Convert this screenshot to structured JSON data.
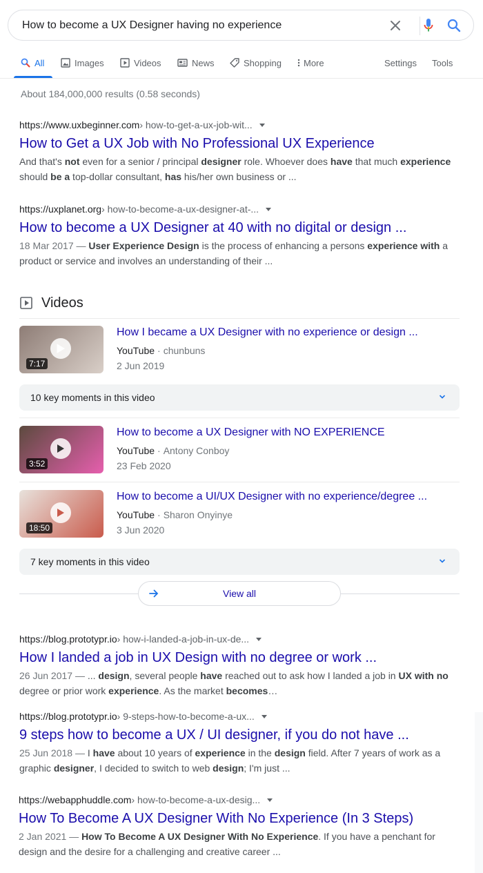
{
  "search": {
    "query": "How to become a UX Designer having no experience"
  },
  "tabs": [
    {
      "label": "All",
      "icon": "search-icon"
    },
    {
      "label": "Images",
      "icon": "image-icon"
    },
    {
      "label": "Videos",
      "icon": "play-square-icon"
    },
    {
      "label": "News",
      "icon": "news-icon"
    },
    {
      "label": "Shopping",
      "icon": "tag-icon"
    },
    {
      "label": "More",
      "icon": "more-vert-icon"
    }
  ],
  "tools": {
    "settings": "Settings",
    "tools": "Tools"
  },
  "result_stats": "About 184,000,000 results (0.58 seconds)",
  "results": [
    {
      "domain": "https://www.uxbeginner.com",
      "path": " › how-to-get-a-ux-job-wit...",
      "title": "How to Get a UX Job with No Professional UX Experience",
      "snippet_html": "And that's <b>not</b> even for a senior / principal <b>designer</b> role. Whoever does <b>have</b> that much <b>experience</b> should <b>be a</b> top-dollar consultant, <b>has</b> his/her own business or ..."
    },
    {
      "domain": "https://uxplanet.org",
      "path": " › how-to-become-a-ux-designer-at-...",
      "title": "How to become a UX Designer at 40 with no digital or design ...",
      "snippet_html": "<span class=\"date\">18 Mar 2017 — </span><b>User Experience Design</b> is the process of enhancing a persons <b>experience with</b> a product or service and involves an understanding of their ..."
    },
    {
      "domain": "https://blog.prototypr.io",
      "path": " › how-i-landed-a-job-in-ux-de...",
      "title": "How I landed a job in UX Design with no degree or work ...",
      "snippet_html": "<span class=\"date\">26 Jun 2017 — </span>... <b>design</b>, several people <b>have</b> reached out to ask how I landed a job in <b>UX with no</b> degree or prior work <b>experience</b>. As the market <b>becomes</b>…"
    },
    {
      "domain": "https://blog.prototypr.io",
      "path": " › 9-steps-how-to-become-a-ux...",
      "title": "9 steps how to become a UX / UI designer, if you do not have ...",
      "snippet_html": "<span class=\"date\">25 Jun 2018 — </span>I <b>have</b> about 10 years of <b>experience</b> in the <b>design</b> field. After 7 years of work as a graphic <b>designer</b>, I decided to switch to web <b>design</b>; I'm just ..."
    },
    {
      "domain": "https://webapphuddle.com",
      "path": " › how-to-become-a-ux-desig...",
      "title": "How To Become A UX Designer With No Experience (In 3 Steps)",
      "snippet_html": "<span class=\"date\">2 Jan 2021 — </span><b>How To Become A UX Designer With No Experience</b>. If you have a penchant for design and the desire for a challenging and creative career ..."
    }
  ],
  "videos": {
    "header": "Videos",
    "items": [
      {
        "title": "How I became a UX Designer with no experience or design ...",
        "source": "YouTube",
        "channel": "chunbuns",
        "date": "2 Jun 2019",
        "duration": "7:17",
        "thumb_colors": [
          "#8e7d76",
          "#d9cfc8"
        ]
      },
      {
        "title": "How to become a UX Designer with NO EXPERIENCE",
        "source": "YouTube",
        "channel": "Antony Conboy",
        "date": "23 Feb 2020",
        "duration": "3:52",
        "thumb_colors": [
          "#5c4a3e",
          "#e65fae"
        ]
      },
      {
        "title": "How to become a UI/UX Designer with no experience/degree ...",
        "source": "YouTube",
        "channel": "Sharon Onyinye",
        "date": "3 Jun 2020",
        "duration": "18:50",
        "thumb_colors": [
          "#e8e2dc",
          "#c95b4c"
        ]
      }
    ],
    "key_moments": [
      "10 key moments in this video",
      "7 key moments in this video"
    ],
    "view_all": "View all"
  },
  "colors": {
    "link": "#1a0dab",
    "accent": "#1a73e8",
    "snippet": "#4d5156",
    "muted": "#70757a"
  }
}
